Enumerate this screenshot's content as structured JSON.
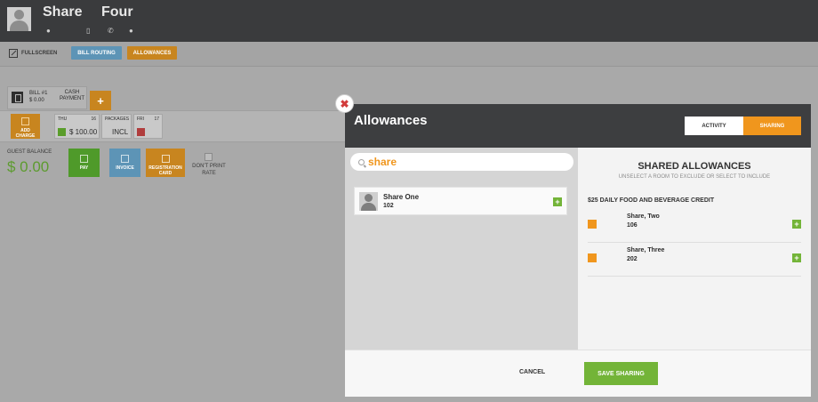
{
  "guest": {
    "first_name": "Share",
    "last_name": "Four"
  },
  "toolbar": {
    "fullscreen": "FULLSCREEN",
    "bill_routing": "BILL ROUTING",
    "allowances": "ALLOWANCES"
  },
  "bill": {
    "name": "BILL #1",
    "amount": "$ 0.00",
    "payment_method": "CASH PAYMENT",
    "add_label": "+",
    "add_charge": "ADD CHARGE",
    "days": [
      {
        "day": "THU",
        "date": "16",
        "value": "$ 100.00"
      },
      {
        "day": "PACKAGES",
        "value": "INCL"
      },
      {
        "day": "FRI",
        "date": "17"
      }
    ]
  },
  "guest_balance": {
    "label": "GUEST BALANCE",
    "value": "$ 0.00"
  },
  "actions": {
    "pay": "PAY",
    "invoice": "INVOICE",
    "registration_card": "REGISTRATION CARD",
    "dont_print_rate": "DON'T PRINT RATE"
  },
  "modal": {
    "close_symbol": "✖",
    "title": "Allowances",
    "tabs": {
      "activity": "ACTIVITY",
      "sharing": "SHARING"
    },
    "search": {
      "value": "share"
    },
    "results": [
      {
        "name": "Share One",
        "room": "102"
      }
    ],
    "shared": {
      "title": "SHARED ALLOWANCES",
      "subtitle": "UNSELECT A ROOM TO EXCLUDE OR SELECT TO INCLUDE",
      "credit_name": "$25 DAILY FOOD AND BEVERAGE CREDIT",
      "rooms": [
        {
          "name": "Share, Two",
          "room": "106"
        },
        {
          "name": "Share, Three",
          "room": "202"
        }
      ]
    },
    "footer": {
      "cancel": "CANCEL",
      "save": "SAVE SHARING"
    }
  },
  "colors": {
    "accent_orange": "#f0961d",
    "accent_green": "#73b438",
    "header_dark": "#3d3e40",
    "balance_green": "#5d9b2f"
  }
}
